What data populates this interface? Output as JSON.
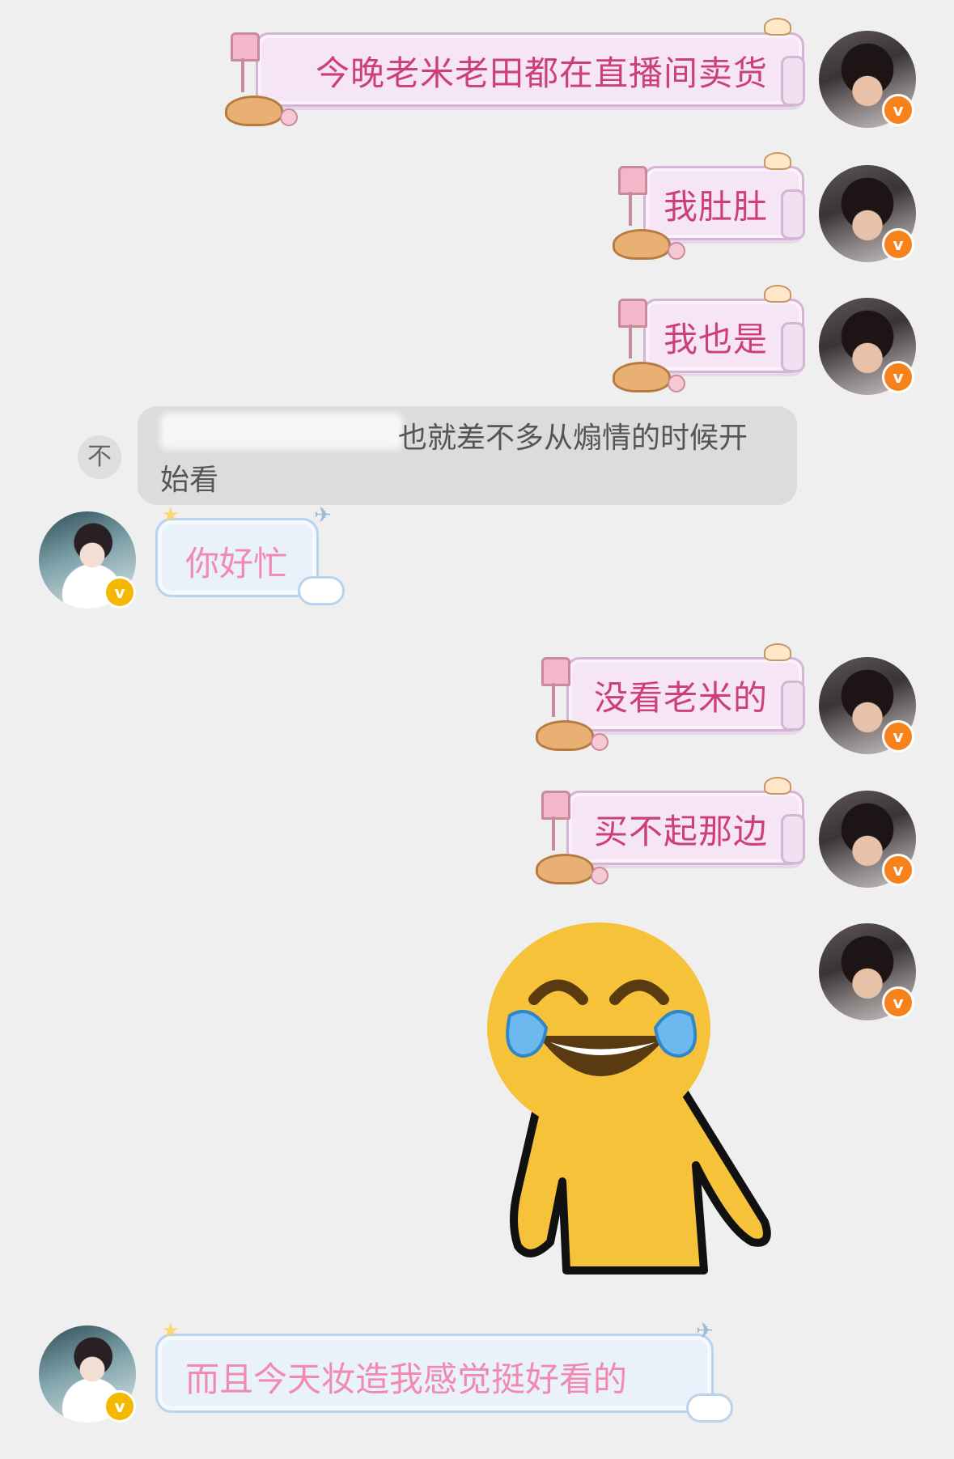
{
  "messages": [
    {
      "side": "out",
      "text": "今晚老米老田都在直播间卖货"
    },
    {
      "side": "out",
      "text": "我肚肚"
    },
    {
      "side": "out",
      "text": "我也是"
    },
    {
      "side": "quote",
      "text_line1": "也就差不多从煽情的时候开",
      "text_line2": "始看",
      "pin_icon": "top-pin-icon",
      "pin_glyph": "不"
    },
    {
      "side": "in",
      "text": "你好忙"
    },
    {
      "side": "out",
      "text": "没看老米的"
    },
    {
      "side": "out",
      "text": "买不起那边"
    },
    {
      "side": "out",
      "sticker": "laughing-crying-emoji-sticker"
    },
    {
      "side": "in",
      "text": "而且今天妆造我感觉挺好看的"
    }
  ],
  "badges": {
    "verified": "v"
  },
  "colors": {
    "background": "#efefef",
    "out_bubble": "#f6e6f5",
    "out_text": "#cc3f7a",
    "in_bubble": "#e9f2fb",
    "in_text": "#f28ab0",
    "badge_orange": "#f7821b",
    "badge_gold": "#f5b800"
  }
}
